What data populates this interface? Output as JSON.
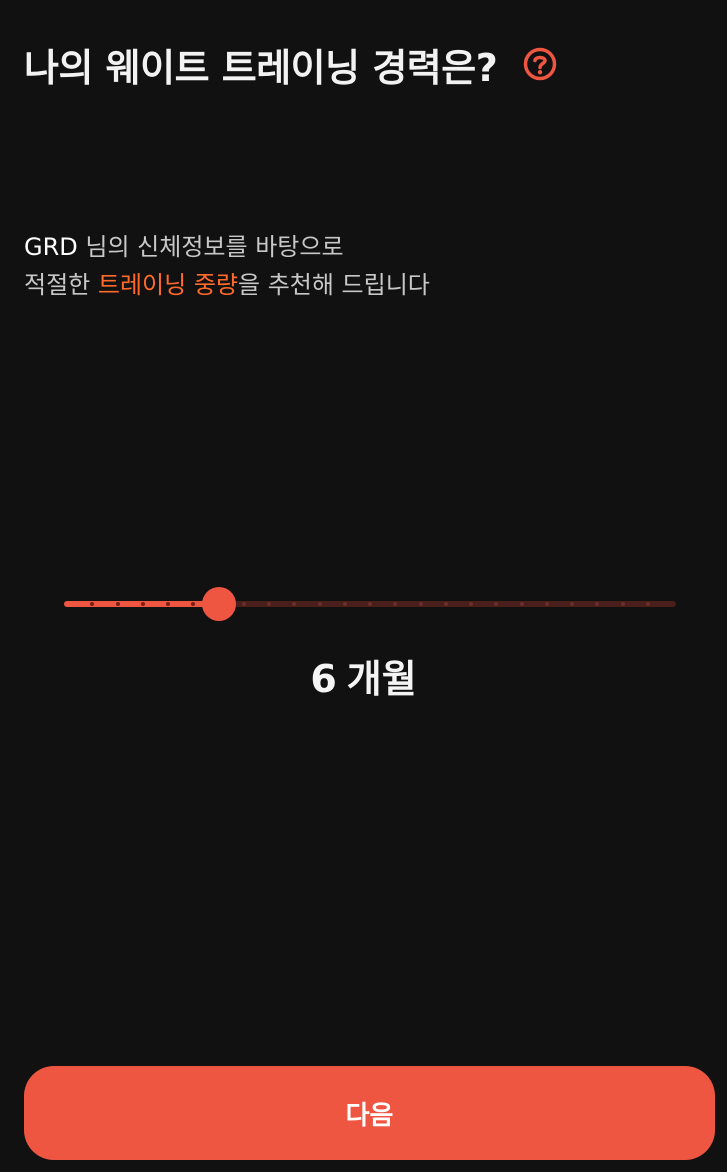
{
  "header": {
    "title": "나의 웨이트 트레이닝 경력은?",
    "help_icon": "question-circle-icon"
  },
  "subtitle": {
    "user_name": "GRD",
    "line1_rest": " 님의 신체정보를 바탕으로",
    "line2_before": "적절한 ",
    "line2_highlight": "트레이닝 중량",
    "line2_after": "을 추천해 드립니다"
  },
  "slider": {
    "value": 6,
    "min": 0,
    "max": 24,
    "value_display": "6",
    "unit": "개월"
  },
  "next_button": {
    "label": "다음"
  },
  "colors": {
    "background": "#111111",
    "accent": "#ef5642",
    "highlight_text": "#ff6a2a",
    "track_inactive": "#4a1f1b"
  }
}
